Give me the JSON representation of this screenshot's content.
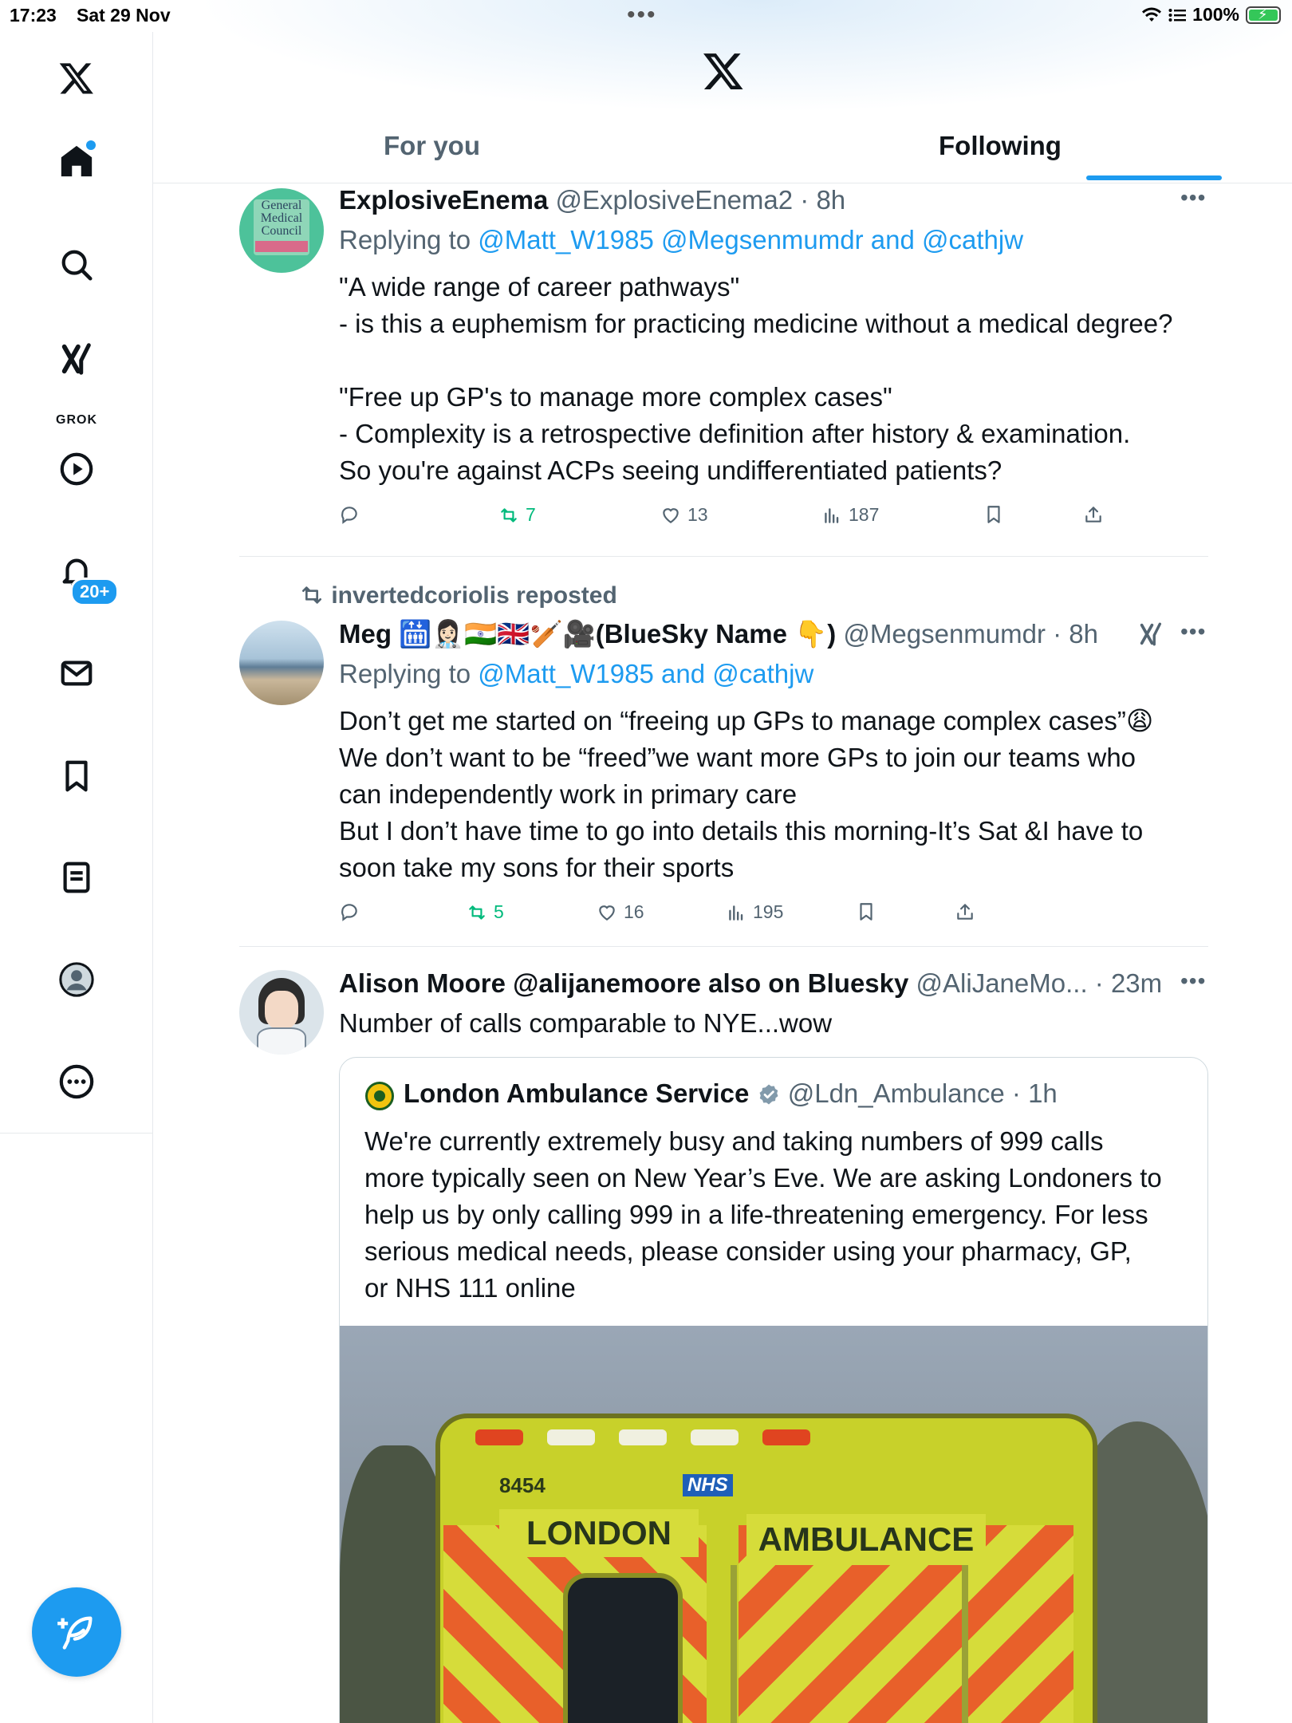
{
  "status_bar": {
    "time": "17:23",
    "date": "Sat 29 Nov",
    "battery": "100%"
  },
  "sidebar": {
    "grok_label": "GROK",
    "notifications_badge": "20+"
  },
  "tabs": [
    {
      "label": "For you",
      "active": false
    },
    {
      "label": "Following",
      "active": true
    }
  ],
  "colors": {
    "accent": "#1d9bf0",
    "retweet_green": "#00ba7c",
    "muted": "#536471"
  },
  "tweets": [
    {
      "name": "ExplosiveEnema",
      "handle": "@ExplosiveEnema2",
      "time": "· 8h",
      "reply_prefix": "Replying to ",
      "reply_to": "@Matt_W1985 @Megsenmumdr and @cathjw",
      "body": "\"A wide range of career pathways\"\n- is this a euphemism for practicing medicine without a medical degree?\n\n\"Free up GP's to manage more complex cases\"\n- Complexity is a retrospective definition after history & examination.\nSo you're against ACPs seeing undifferentiated patients?",
      "avatar_text": [
        "General",
        "Medical",
        "Council"
      ],
      "stats": {
        "replies": "",
        "reposts": "7",
        "likes": "13",
        "views": "187"
      }
    },
    {
      "repost_by": "invertedcoriolis reposted",
      "name": "Meg 🛗👩🏻‍⚕️🇮🇳🇬🇧🏏🎥(BlueSky Name 👇)",
      "handle": "@Megsenmumdr",
      "time": "· 8h",
      "reply_prefix": "Replying to ",
      "reply_to": "@Matt_W1985 and @cathjw",
      "body": "Don’t get me started on “freeing up GPs to manage complex cases”😩\nWe don’t want to be “freed”we want more GPs to join our teams who\ncan independently work in primary care\nBut I don’t have time to go into details this morning-It’s Sat &I have to\nsoon take my sons for their sports",
      "stats": {
        "replies": "",
        "reposts": "5",
        "likes": "16",
        "views": "195"
      }
    },
    {
      "name": "Alison Moore @alijanemoore also on Bluesky",
      "handle": "@AliJaneMo...",
      "time": "· 23m",
      "body": "Number of calls comparable to NYE...wow",
      "quote": {
        "name": "London Ambulance Service",
        "handle": "@Ldn_Ambulance",
        "time": "· 1h",
        "body": "We're currently extremely busy and taking numbers of 999 calls\nmore typically seen on New Year’s Eve. We are asking Londoners to\nhelp us by only calling 999 in a life-threatening emergency. For less\nserious medical needs, please consider using your pharmacy, GP,\nor NHS 111 online",
        "image_text": {
          "fleet_no": "8454",
          "nhs": "NHS",
          "left": "LONDON",
          "right": "AMBULANCE"
        }
      }
    }
  ]
}
